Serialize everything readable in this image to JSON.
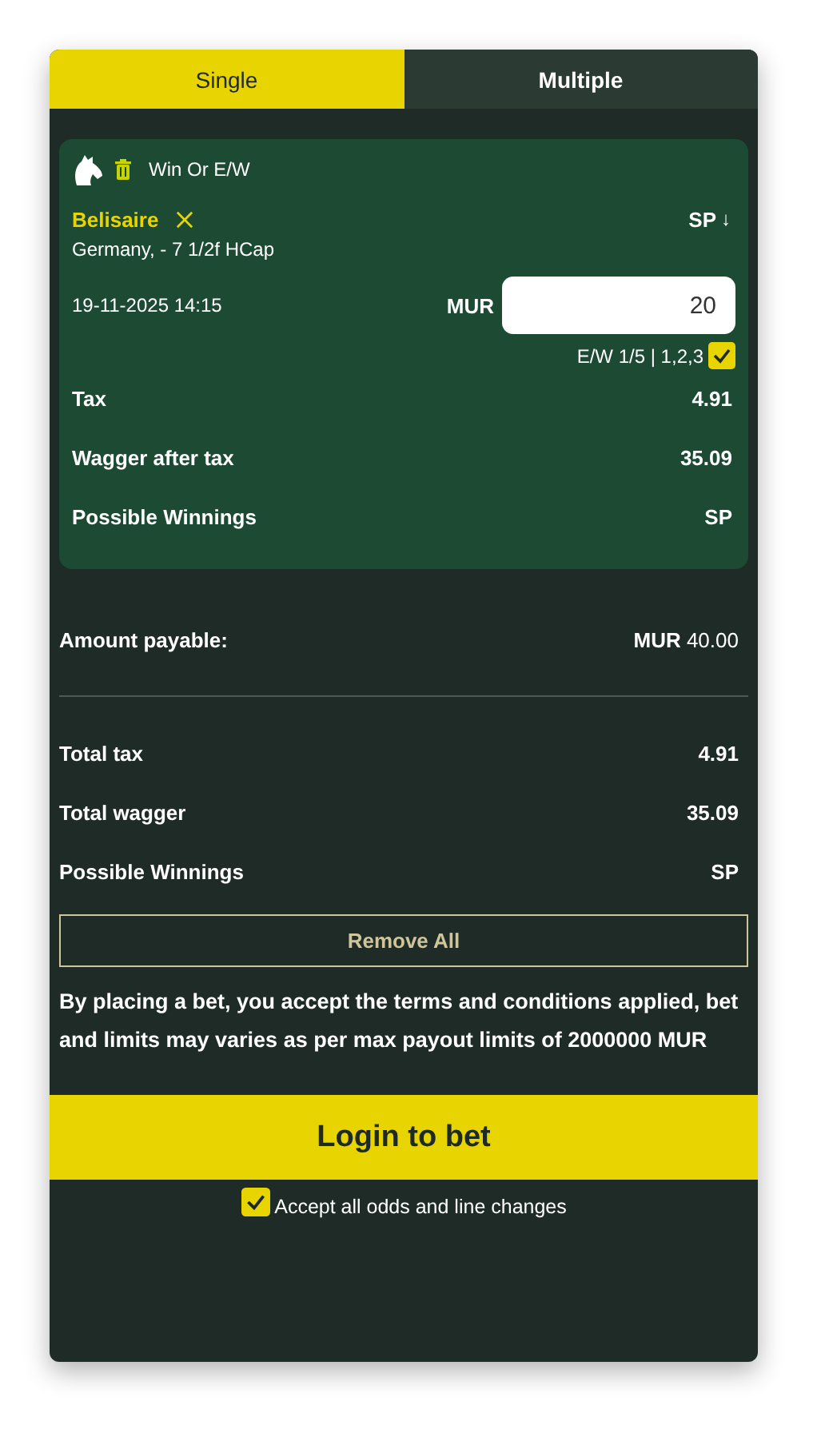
{
  "tabs": [
    {
      "label": "Single",
      "selected": true
    },
    {
      "label": "Multiple",
      "selected": false
    }
  ],
  "bet": {
    "market": "Win Or E/W",
    "selection": "Belisaire",
    "odds": "SP",
    "odds_arrow": "↓",
    "event": "Germany, - 7 1/2f HCap",
    "datetime": "19-11-2025 14:15",
    "currency": "MUR",
    "stake": "20",
    "each_way": {
      "label": "E/W 1/5 | 1,2,3",
      "checked": true
    },
    "rows": [
      {
        "label": "Tax",
        "value": "4.91"
      },
      {
        "label": "Wagger after tax",
        "value": "35.09"
      },
      {
        "label": "Possible Winnings",
        "value": "SP"
      }
    ]
  },
  "amount_payable": {
    "label": "Amount payable:",
    "currency": "MUR",
    "value": "40.00"
  },
  "totals": [
    {
      "label": "Total tax",
      "value": "4.91"
    },
    {
      "label": "Total wagger",
      "value": "35.09"
    },
    {
      "label": "Possible Winnings",
      "value": "SP"
    }
  ],
  "remove_all": "Remove All",
  "disclaimer": "By placing a bet, you accept the terms and conditions applied, bet and limits may varies as per max payout limits of 2000000 MUR",
  "login_button": "Login to bet",
  "accept_changes": {
    "label": "Accept all odds and line changes",
    "checked": true
  }
}
